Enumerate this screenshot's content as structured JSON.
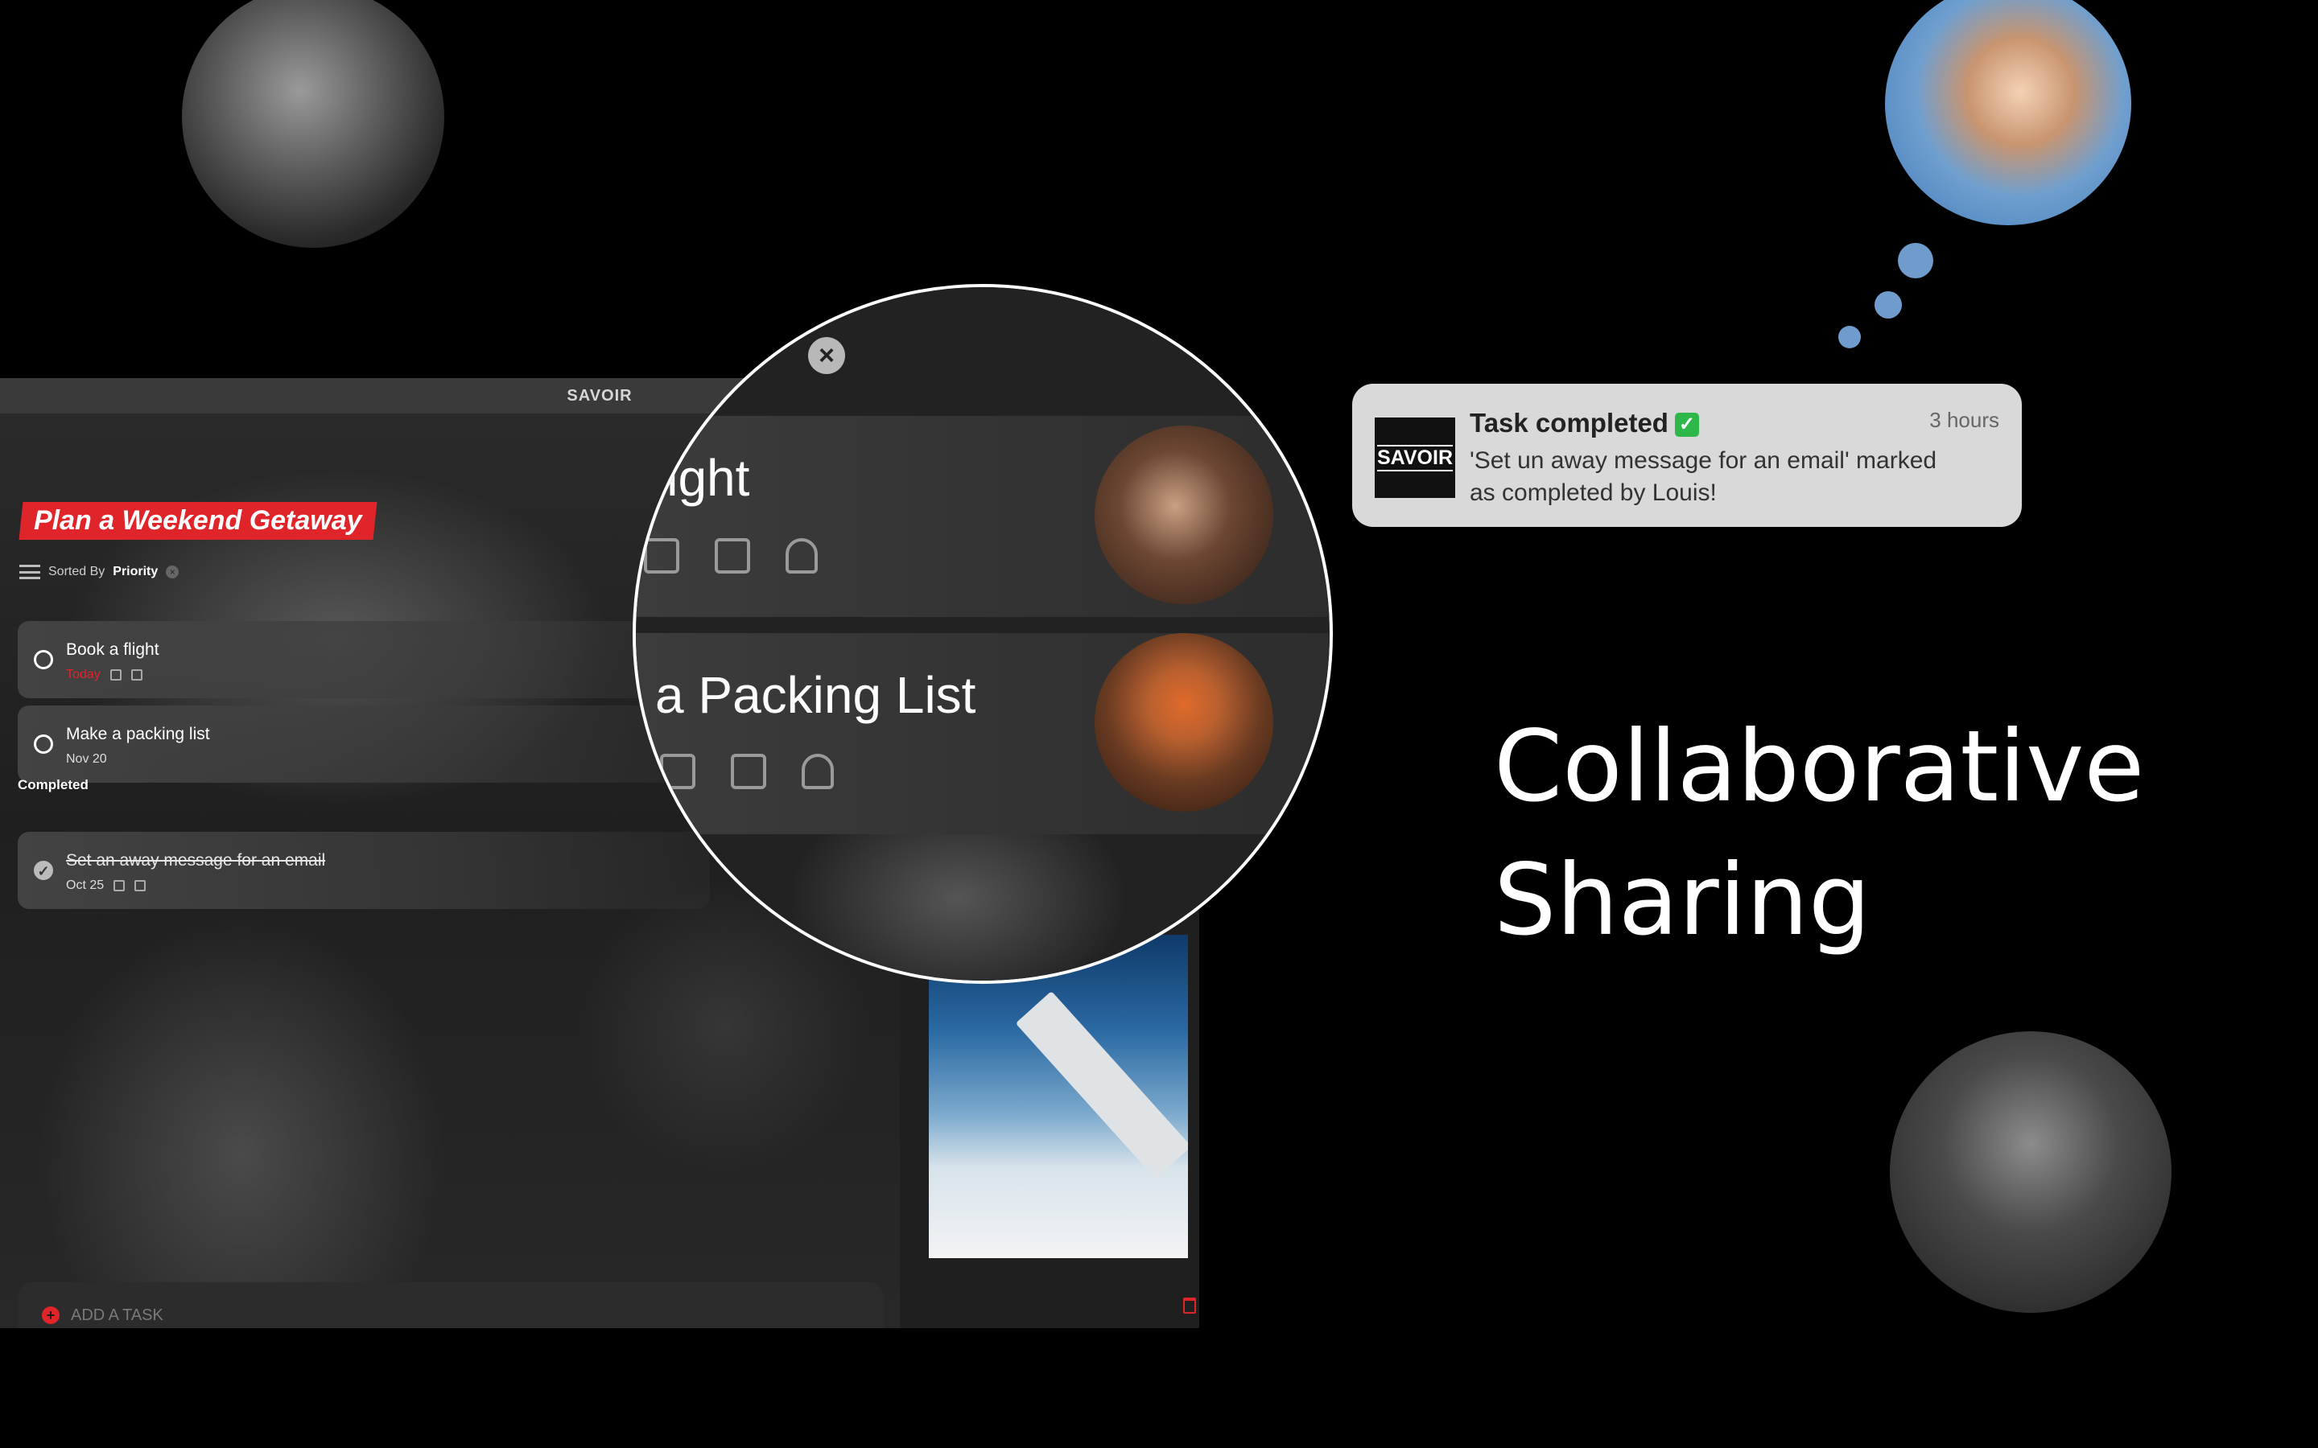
{
  "app": {
    "window_title": "SAVOIR",
    "list_title": "Plan a Weekend Getaway",
    "sort": {
      "prefix": "Sorted By",
      "value": "Priority",
      "clear_symbol": "×"
    },
    "tasks": [
      {
        "title": "Book a flight",
        "date": "Today"
      },
      {
        "title": "Make a packing list",
        "date": "Nov 20"
      }
    ],
    "completed_label": "Completed",
    "completed_tasks": [
      {
        "title": "Set an away message for an email",
        "date": "Oct 25",
        "check": "✓"
      }
    ],
    "add_task_placeholder": "ADD A TASK",
    "add_symbol": "+"
  },
  "magnifier": {
    "close_symbol": "×",
    "row1_text": "light",
    "row2_text": "a Packing List"
  },
  "notification": {
    "app_logo_text": "SAVOIR",
    "title": "Task completed",
    "check": "✓",
    "time": "3 hours",
    "body": "'Set un away message for an email' marked as completed by Louis!"
  },
  "headline": {
    "line1": "Collaborative",
    "line2": "Sharing"
  },
  "colors": {
    "accent_red": "#e0252a",
    "bubble_blue": "#6f9ccd",
    "notification_bg": "#d9d9d9",
    "check_green": "#2fb84a"
  }
}
